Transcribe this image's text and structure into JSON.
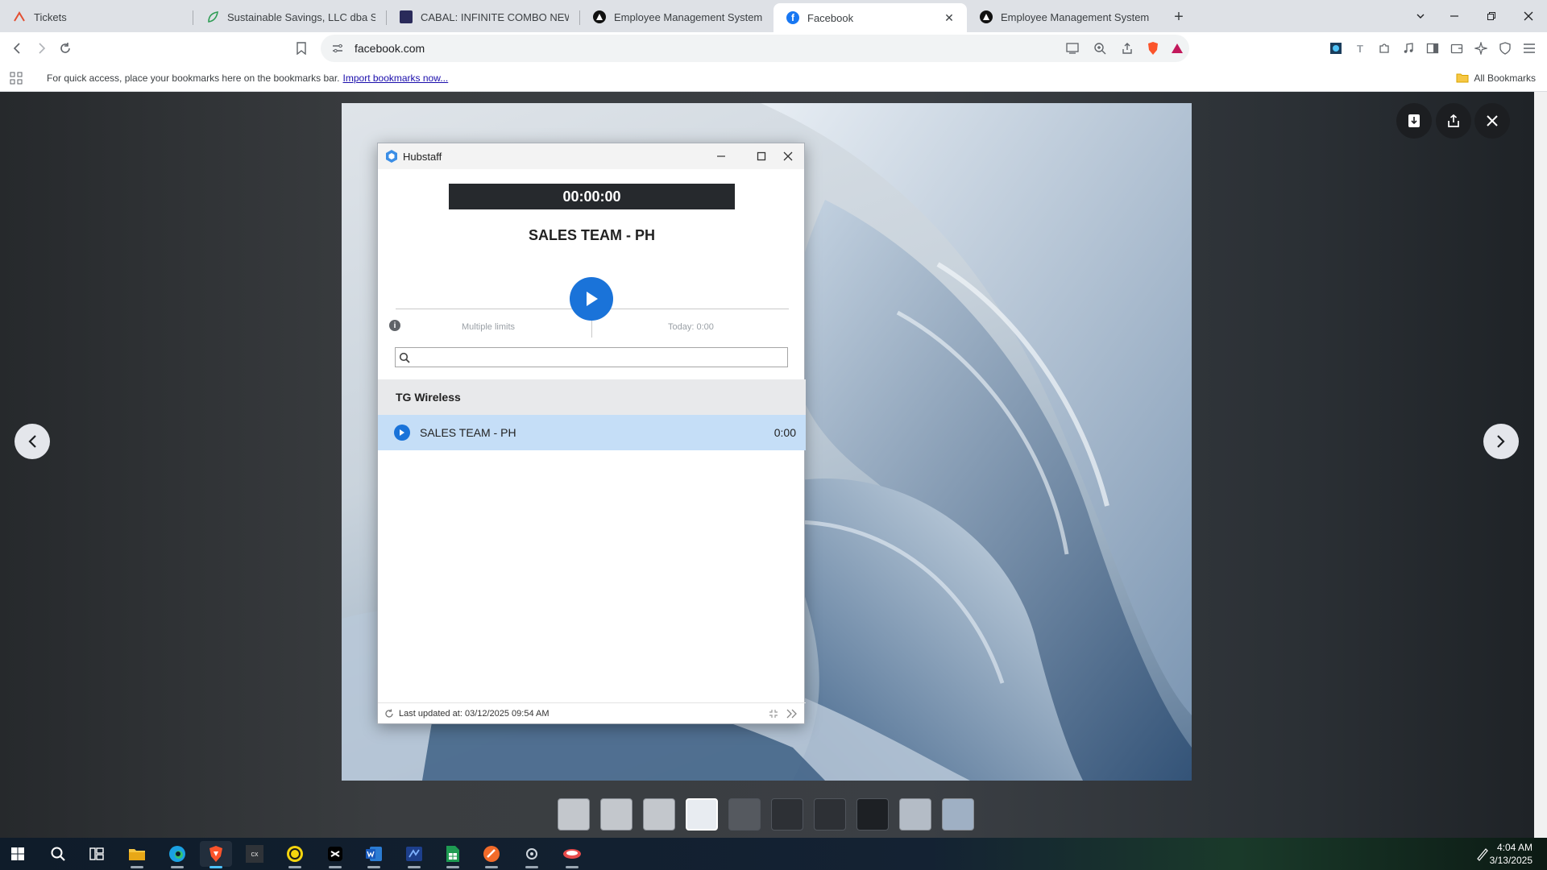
{
  "browser": {
    "tabs": [
      {
        "title": "Tickets",
        "favicon": "zendesk-icon",
        "color": "#e34f32"
      },
      {
        "title": "Sustainable Savings, LLC dba Susta",
        "favicon": "leaf-icon",
        "color": "#2e9d55"
      },
      {
        "title": "CABAL: INFINITE COMBO NEWS",
        "favicon": "cabal-icon",
        "color": "#2a2a5a"
      },
      {
        "title": "Employee Management System",
        "favicon": "circle-logo-icon",
        "color": "#111111"
      },
      {
        "title": "Facebook",
        "favicon": "facebook-icon",
        "color": "#1877f2"
      },
      {
        "title": "Employee Management System",
        "favicon": "circle-logo-icon",
        "color": "#111111"
      }
    ],
    "active_tab": 4,
    "url": "facebook.com",
    "bookmarks_bar": {
      "message": "For quick access, place your bookmarks here on the bookmarks bar.",
      "link": "Import bookmarks now...",
      "all_bookmarks": "All Bookmarks"
    }
  },
  "hubstaff": {
    "window_title": "Hubstaff",
    "timer": "00:00:00",
    "project_title": "SALES TEAM - PH",
    "limits_label": "Multiple limits",
    "today_label": "Today: 0:00",
    "search_placeholder": "",
    "organization": "TG Wireless",
    "projects": [
      {
        "name": "SALES TEAM - PH",
        "time": "0:00"
      }
    ],
    "last_updated": "Last updated at: 03/12/2025 09:54 AM",
    "accent_color": "#1a73d9"
  },
  "taskbar": {
    "time": "4:04 AM",
    "date": "3/13/2025",
    "apps": [
      "windows-start-icon",
      "search-icon",
      "task-view-icon",
      "file-explorer-icon",
      "edge-icon",
      "brave-icon",
      "cx-app-icon",
      "chat-app-icon",
      "capcut-icon",
      "word-icon",
      "remote-app-icon",
      "sheets-icon",
      "swift-app-icon",
      "settings-app-icon",
      "hubstaff-app-icon"
    ]
  }
}
